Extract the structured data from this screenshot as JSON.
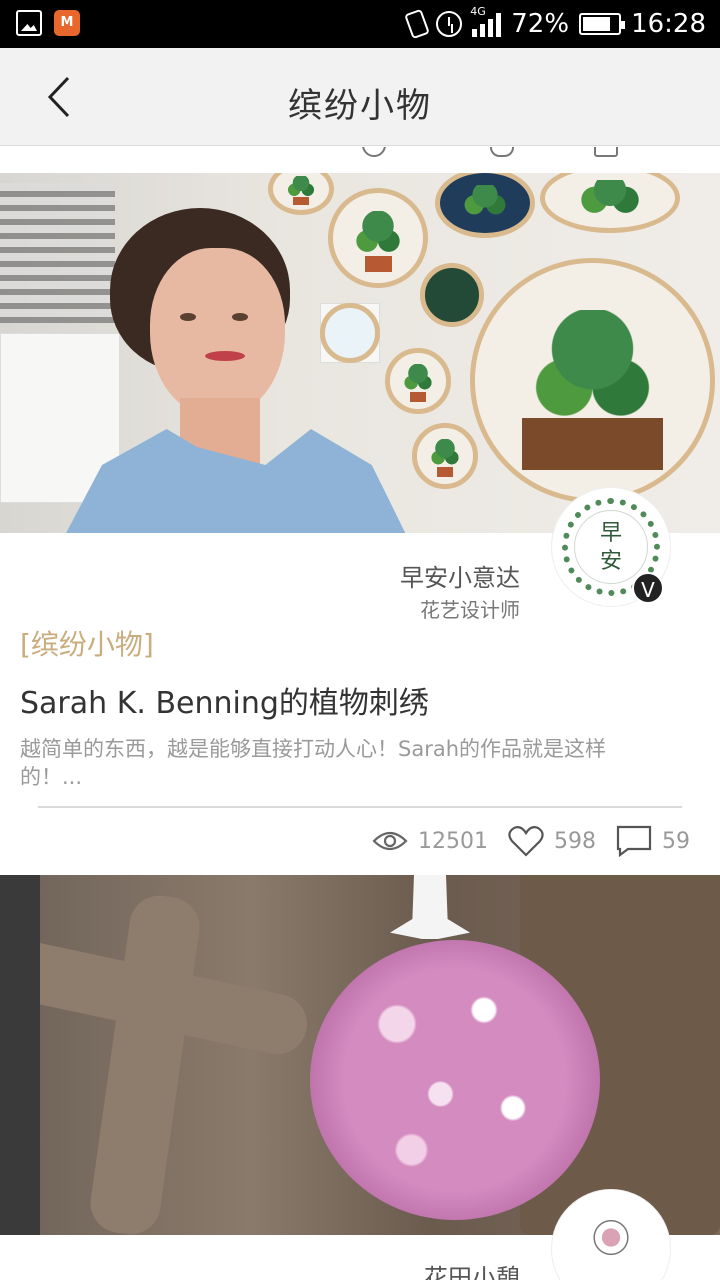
{
  "status_bar": {
    "battery": "72%",
    "time": "16:28",
    "network": "4G",
    "icons": [
      "gallery-icon",
      "video-app-icon",
      "mute-icon",
      "alarm-icon",
      "signal-icon",
      "battery-icon"
    ]
  },
  "nav": {
    "title": "缤纷小物",
    "back_icon": "chevron-left-icon"
  },
  "articles": [
    {
      "author_name": "早安小意达",
      "author_title": "花艺设计师",
      "avatar_text": [
        "早",
        "安"
      ],
      "verified_badge": "V",
      "category": "[缤纷小物]",
      "title": "Sarah K. Benning的植物刺绣",
      "excerpt": "越简单的东西，越是能够直接打动人心！Sarah的作品就是这样的！...",
      "views": "12501",
      "likes": "598",
      "comments": "59"
    },
    {
      "author_name": "花田小憩"
    }
  ],
  "colors": {
    "category": "#c9ad7e",
    "nav_bg": "#f2f2f2",
    "status_bg": "#000000",
    "text_muted": "#999999"
  }
}
